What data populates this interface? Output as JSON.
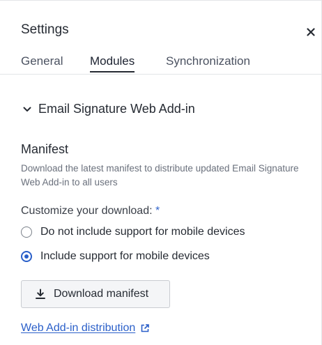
{
  "panel": {
    "title": "Settings"
  },
  "tabs": [
    {
      "label": "General",
      "active": false
    },
    {
      "label": "Modules",
      "active": true
    },
    {
      "label": "Synchronization",
      "active": false
    }
  ],
  "section": {
    "title": "Email Signature Web Add-in",
    "expanded": true
  },
  "manifest": {
    "title": "Manifest",
    "description": "Download the latest manifest to distribute updated Email Signature Web Add-in to all users",
    "customize_label": "Customize your download:",
    "required_marker": "*",
    "options": [
      {
        "label": "Do not include support for mobile devices",
        "selected": false
      },
      {
        "label": "Include support for mobile devices",
        "selected": true
      }
    ],
    "download_button": "Download manifest",
    "link_text": "Web Add-in distribution"
  },
  "colors": {
    "accent": "#2a5fc9",
    "text": "#262b33",
    "muted": "#6a707c"
  }
}
